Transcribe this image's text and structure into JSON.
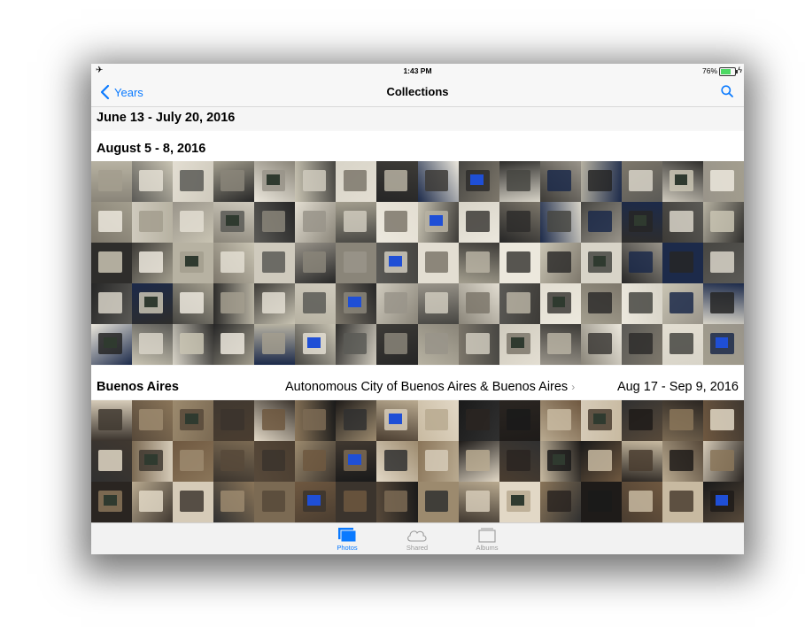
{
  "status_bar": {
    "time": "1:43 PM",
    "battery_percent": "76%",
    "battery_level": 0.76,
    "airplane_icon": "airplane-icon",
    "charging_icon": "bolt-icon"
  },
  "nav": {
    "back_label": "Years",
    "title": "Collections",
    "search_icon": "search-icon"
  },
  "colors": {
    "accent": "#0a7aff",
    "battery": "#4cd964"
  },
  "sections": [
    {
      "title": "June 13 - July 20, 2016"
    },
    {
      "title": "August 5 - 8, 2016"
    },
    {
      "title": "Buenos Aires",
      "location": "Autonomous City of Buenos Aires & Buenos Aires",
      "location_arrow": "›",
      "dates": "Aug 17 - Sep 9, 2016"
    }
  ],
  "photo_grids": {
    "august": {
      "rows": 5,
      "columns": 16
    },
    "buenos_aires": {
      "rows": 3,
      "columns": 16
    }
  },
  "tabs": [
    {
      "label": "Photos",
      "icon": "photos-icon",
      "active": true
    },
    {
      "label": "Shared",
      "icon": "cloud-icon",
      "active": false
    },
    {
      "label": "Albums",
      "icon": "albums-icon",
      "active": false
    }
  ]
}
